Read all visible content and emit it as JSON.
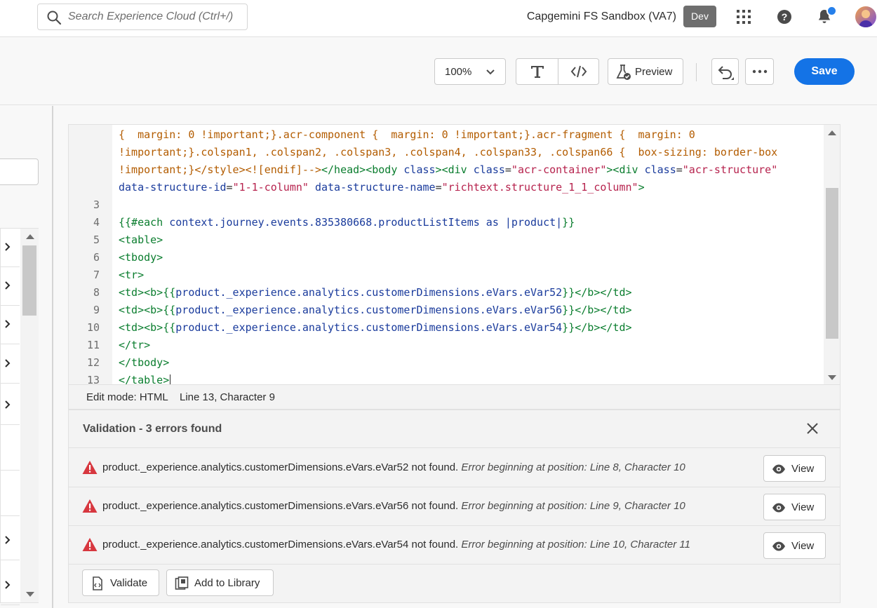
{
  "header": {
    "search_placeholder": "Search Experience Cloud (Ctrl+/)",
    "org_name": "Capgemini FS Sandbox (VA7)",
    "env_badge": "Dev",
    "icons": [
      "search-icon",
      "apps-grid-icon",
      "help-icon",
      "bell-icon",
      "avatar"
    ]
  },
  "toolbar": {
    "zoom_value": "100%",
    "preview_label": "Preview",
    "save_label": "Save",
    "accent_color": "#1473e6"
  },
  "editor": {
    "lines": [
      {
        "n": "",
        "html": "<span class='c-txt'>{  margin: 0 !important;}.acr-component {  margin: 0 !important;}.acr-fragment {  margin: 0</span>"
      },
      {
        "n": "",
        "html": "<span class='c-txt'>!important;}.colspan1, .colspan2, .colspan3, .colspan4, .colspan33, .colspan66 {  box-sizing: border-box</span>"
      },
      {
        "n": "",
        "html": "<span class='c-txt'>!important;}&lt;/style&gt;&lt;![endif]--&gt;</span><span class='c-tag'>&lt;/head&gt;&lt;body</span> <span class='c-attr'>class</span><span class='c-tag'>&gt;&lt;div</span> <span class='c-attr'>class</span>=<span class='c-str'>\"acr-container\"</span><span class='c-tag'>&gt;&lt;div</span> <span class='c-attr'>class</span>=<span class='c-str'>\"acr-structure\"</span>"
      },
      {
        "n": "",
        "html": "<span class='c-attr'>data-structure-id</span>=<span class='c-str'>\"1-1-column\"</span> <span class='c-attr'>data-structure-name</span>=<span class='c-str'>\"richtext.structure_1_1_column\"</span><span class='c-tag'>&gt;</span>"
      },
      {
        "n": "3",
        "html": ""
      },
      {
        "n": "4",
        "html": "<span class='c-tag'>{{#each</span> <span class='c-hb'>context.journey.events.835380668.productListItems as |product|</span><span class='c-tag'>}}</span>"
      },
      {
        "n": "5",
        "html": "<span class='c-tag'>&lt;table&gt;</span>"
      },
      {
        "n": "6",
        "html": "<span class='c-tag'>&lt;tbody&gt;</span>"
      },
      {
        "n": "7",
        "html": "<span class='c-tag'>&lt;tr&gt;</span>"
      },
      {
        "n": "8",
        "html": "<span class='c-tag'>&lt;td&gt;&lt;b&gt;{{</span><span class='c-hb'>product._experience.analytics.customerDimensions.eVars.eVar52</span><span class='c-tag'>}}&lt;/b&gt;&lt;/td&gt;</span>"
      },
      {
        "n": "9",
        "html": "<span class='c-tag'>&lt;td&gt;&lt;b&gt;{{</span><span class='c-hb'>product._experience.analytics.customerDimensions.eVars.eVar56</span><span class='c-tag'>}}&lt;/b&gt;&lt;/td&gt;</span>"
      },
      {
        "n": "10",
        "html": "<span class='c-tag'>&lt;td&gt;&lt;b&gt;{{</span><span class='c-hb'>product._experience.analytics.customerDimensions.eVars.eVar54</span><span class='c-tag'>}}&lt;/b&gt;&lt;/td&gt;</span>"
      },
      {
        "n": "11",
        "html": "<span class='c-tag'>&lt;/tr&gt;</span>"
      },
      {
        "n": "12",
        "html": "<span class='c-tag'>&lt;/tbody&gt;</span>"
      },
      {
        "n": "13",
        "html": "<span class='c-tag'>&lt;/table&gt;</span>"
      }
    ]
  },
  "status": {
    "mode": "Edit mode: HTML",
    "position": "Line 13, Character 9"
  },
  "validation": {
    "title": "Validation - 3 errors found",
    "errors": [
      {
        "message": "product._experience.analytics.customerDimensions.eVars.eVar52 not found.",
        "detail": "Error beginning at position: Line 8, Character 10",
        "view_label": "View"
      },
      {
        "message": "product._experience.analytics.customerDimensions.eVars.eVar56 not found.",
        "detail": "Error beginning at position: Line 9, Character 10",
        "view_label": "View"
      },
      {
        "message": "product._experience.analytics.customerDimensions.eVars.eVar54 not found.",
        "detail": "Error beginning at position: Line 10, Character 11",
        "view_label": "View"
      }
    ],
    "error_color": "#d7373f",
    "validate_label": "Validate",
    "add_library_label": "Add to Library"
  }
}
